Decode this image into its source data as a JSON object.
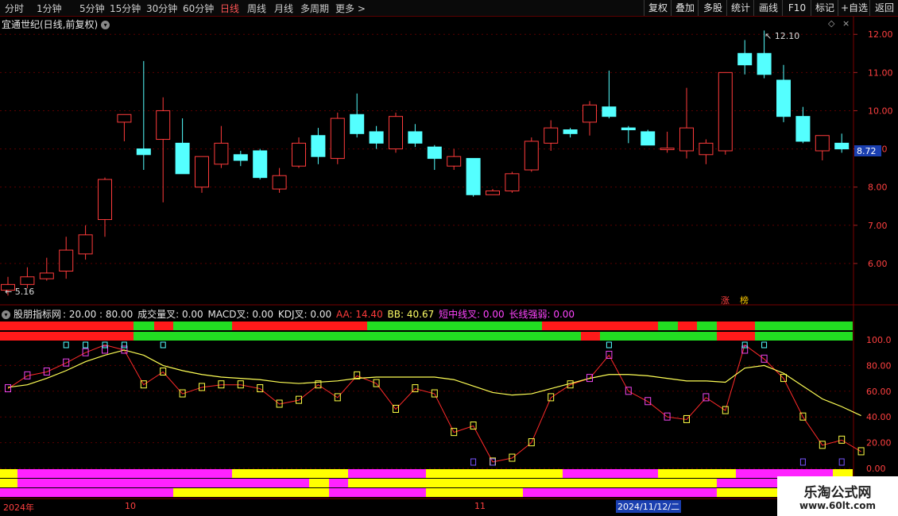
{
  "toolbar": {
    "periods": [
      "分时",
      "1分钟",
      "5分钟",
      "15分钟",
      "30分钟",
      "60分钟",
      "日线",
      "周线",
      "月线",
      "多周期",
      "更多 >"
    ],
    "active_period": "日线",
    "right_buttons": [
      "复权",
      "叠加",
      "多股",
      "统计",
      "画线",
      "F10",
      "标记",
      "+自选",
      "返回"
    ]
  },
  "main_chart": {
    "title": "宜通世纪(日线,前复权)",
    "price_ticks": [
      "12.00",
      "11.00",
      "10.00",
      "9.00",
      "8.00",
      "7.00",
      "6.00"
    ],
    "current_price": "8.72",
    "high_label": "12.10",
    "low_label": "5.16",
    "zhang_label": "涨",
    "bang_label": "榜",
    "colors": {
      "up": "#ff3b3b",
      "down": "#54ffff",
      "current_price_bg": "#1a3fb0"
    }
  },
  "indicator": {
    "title": "股朋指标网",
    "params": ": 20.00 : 80.00",
    "vol_cross": "成交量叉: 0.00",
    "macd_cross": "MACD叉: 0.00",
    "kdj_cross": "KDJ叉: 0.00",
    "aa": "AA: 14.40",
    "bb": "BB: 40.67",
    "short_mid": "短中线叉: 0.00",
    "long_strength": "长线强弱: 0.00",
    "ticks": [
      "100.0",
      "80.00",
      "60.00",
      "40.00",
      "20.00",
      "0.00"
    ]
  },
  "date_axis": {
    "labels": [
      "2024年",
      "10",
      "11"
    ],
    "cursor_date": "2024/11/12/二"
  },
  "watermark": {
    "line1": "乐淘公式网",
    "line2": "www.60lt.com"
  },
  "chart_data": {
    "type": "candlestick",
    "y_range": [
      5.0,
      12.4
    ],
    "candles": [
      {
        "o": 5.3,
        "h": 5.65,
        "l": 5.16,
        "c": 5.45
      },
      {
        "o": 5.45,
        "h": 5.9,
        "l": 5.35,
        "c": 5.65
      },
      {
        "o": 5.6,
        "h": 6.15,
        "l": 5.55,
        "c": 5.75
      },
      {
        "o": 5.8,
        "h": 6.7,
        "l": 5.6,
        "c": 6.35
      },
      {
        "o": 6.25,
        "h": 7.0,
        "l": 6.1,
        "c": 6.75
      },
      {
        "o": 7.15,
        "h": 8.25,
        "l": 6.7,
        "c": 8.2
      },
      {
        "o": 9.7,
        "h": 9.85,
        "l": 9.2,
        "c": 9.9
      },
      {
        "o": 9.0,
        "h": 11.3,
        "l": 8.45,
        "c": 8.85
      },
      {
        "o": 9.25,
        "h": 10.35,
        "l": 7.6,
        "c": 10.0
      },
      {
        "o": 9.15,
        "h": 9.8,
        "l": 8.35,
        "c": 8.35
      },
      {
        "o": 8.0,
        "h": 8.8,
        "l": 7.85,
        "c": 8.8
      },
      {
        "o": 8.6,
        "h": 9.6,
        "l": 8.5,
        "c": 9.15
      },
      {
        "o": 8.85,
        "h": 8.95,
        "l": 8.55,
        "c": 8.7
      },
      {
        "o": 8.95,
        "h": 9.0,
        "l": 8.2,
        "c": 8.25
      },
      {
        "o": 7.95,
        "h": 8.5,
        "l": 7.85,
        "c": 8.3
      },
      {
        "o": 8.55,
        "h": 9.3,
        "l": 8.5,
        "c": 9.15
      },
      {
        "o": 9.35,
        "h": 9.55,
        "l": 8.6,
        "c": 8.8
      },
      {
        "o": 8.75,
        "h": 9.95,
        "l": 8.6,
        "c": 9.8
      },
      {
        "o": 9.9,
        "h": 10.45,
        "l": 9.3,
        "c": 9.4
      },
      {
        "o": 9.45,
        "h": 9.6,
        "l": 9.0,
        "c": 9.15
      },
      {
        "o": 9.0,
        "h": 9.95,
        "l": 8.9,
        "c": 9.85
      },
      {
        "o": 9.45,
        "h": 9.65,
        "l": 9.05,
        "c": 9.15
      },
      {
        "o": 9.05,
        "h": 9.1,
        "l": 8.45,
        "c": 8.75
      },
      {
        "o": 8.55,
        "h": 9.0,
        "l": 8.45,
        "c": 8.8
      },
      {
        "o": 8.75,
        "h": 8.75,
        "l": 7.75,
        "c": 7.8
      },
      {
        "o": 7.8,
        "h": 7.95,
        "l": 7.8,
        "c": 7.9
      },
      {
        "o": 7.9,
        "h": 8.4,
        "l": 7.85,
        "c": 8.35
      },
      {
        "o": 8.45,
        "h": 9.3,
        "l": 8.4,
        "c": 9.2
      },
      {
        "o": 9.15,
        "h": 9.75,
        "l": 8.95,
        "c": 9.55
      },
      {
        "o": 9.5,
        "h": 9.55,
        "l": 9.3,
        "c": 9.4
      },
      {
        "o": 9.7,
        "h": 10.25,
        "l": 9.35,
        "c": 10.15
      },
      {
        "o": 10.1,
        "h": 11.05,
        "l": 9.8,
        "c": 9.85
      },
      {
        "o": 9.55,
        "h": 9.6,
        "l": 9.15,
        "c": 9.5
      },
      {
        "o": 9.45,
        "h": 9.5,
        "l": 9.15,
        "c": 9.1
      },
      {
        "o": 8.98,
        "h": 9.45,
        "l": 8.9,
        "c": 9.02
      },
      {
        "o": 8.95,
        "h": 10.6,
        "l": 8.75,
        "c": 9.55
      },
      {
        "o": 8.85,
        "h": 9.25,
        "l": 8.6,
        "c": 9.15
      },
      {
        "o": 8.95,
        "h": 11.0,
        "l": 8.85,
        "c": 11.0
      },
      {
        "o": 11.5,
        "h": 11.85,
        "l": 10.95,
        "c": 11.2
      },
      {
        "o": 11.5,
        "h": 12.1,
        "l": 10.85,
        "c": 10.95
      },
      {
        "o": 10.8,
        "h": 11.2,
        "l": 9.7,
        "c": 9.85
      },
      {
        "o": 9.85,
        "h": 10.1,
        "l": 9.15,
        "c": 9.2
      },
      {
        "o": 8.95,
        "h": 9.3,
        "l": 8.7,
        "c": 9.35
      },
      {
        "o": 9.15,
        "h": 9.4,
        "l": 8.9,
        "c": 9.0
      }
    ],
    "indicator": {
      "y_range": [
        0,
        100
      ],
      "red_line": [
        62,
        72,
        75,
        82,
        90,
        96,
        92,
        65,
        75,
        58,
        63,
        65,
        65,
        62,
        50,
        53,
        65,
        55,
        72,
        66,
        46,
        62,
        58,
        28,
        33,
        5,
        8,
        20,
        55,
        65,
        70,
        88,
        60,
        52,
        40,
        38,
        55,
        45,
        96,
        85,
        70,
        40,
        18,
        22,
        13
      ],
      "yellow_line": [
        63,
        65,
        70,
        76,
        83,
        88,
        92,
        88,
        80,
        76,
        73,
        71,
        70,
        69,
        67,
        66,
        67,
        68,
        70,
        71,
        71,
        71,
        71,
        69,
        64,
        59,
        57,
        58,
        62,
        66,
        70,
        73,
        73,
        72,
        70,
        68,
        68,
        67,
        78,
        80,
        74,
        64,
        54,
        48,
        41
      ]
    }
  }
}
